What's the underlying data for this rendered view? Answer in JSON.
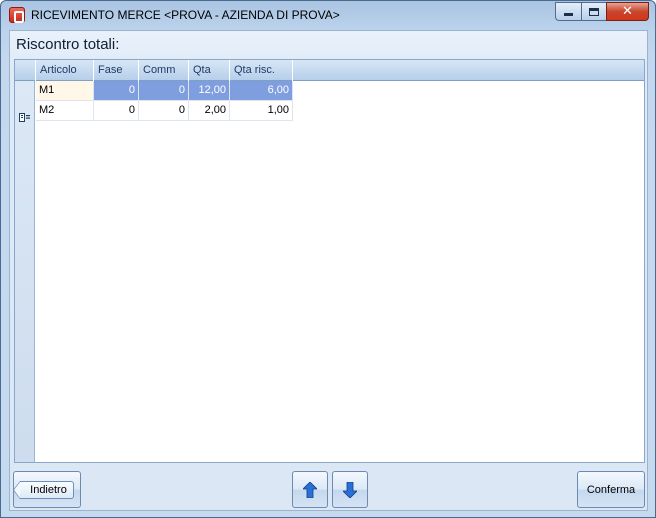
{
  "window": {
    "title": "RICEVIMENTO MERCE <PROVA - AZIENDA DI PROVA>"
  },
  "section": {
    "title": "Riscontro totali:"
  },
  "grid": {
    "columns": [
      "Articolo",
      "Fase",
      "Comm",
      "Qta",
      "Qta risc."
    ],
    "rows": [
      {
        "articolo": "M1",
        "fase": "0",
        "comm": "0",
        "qta": "12,00",
        "qta_risc": "6,00"
      },
      {
        "articolo": "M2",
        "fase": "0",
        "comm": "0",
        "qta": "2,00",
        "qta_risc": "1,00"
      }
    ],
    "selected_row": 0
  },
  "buttons": {
    "back_label": "Indietro",
    "confirm_label": "Conferma"
  },
  "icons": {
    "up": "arrow-up-icon",
    "down": "arrow-down-icon",
    "row_indicator": "row-edit-icon"
  },
  "colors": {
    "selection": "#7f9ee0",
    "arrow": "#2a6fd6"
  }
}
